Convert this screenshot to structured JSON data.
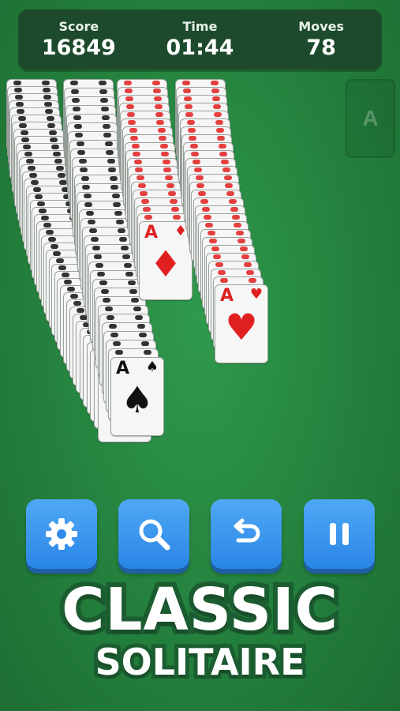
{
  "hud": {
    "score_label": "Score",
    "score_value": "16849",
    "time_label": "Time",
    "time_value": "01:44",
    "moves_label": "Moves",
    "moves_value": "78"
  },
  "foundation": {
    "placeholder_letter": "A"
  },
  "featured_cards": [
    {
      "rank": "A",
      "suit": "♣",
      "color": "#111111"
    },
    {
      "rank": "A",
      "suit": "♠",
      "color": "#111111"
    },
    {
      "rank": "A",
      "suit": "♦",
      "color": "#e02020"
    },
    {
      "rank": "A",
      "suit": "♥",
      "color": "#e02020"
    }
  ],
  "buttons": [
    {
      "name": "settings-button",
      "icon": "gear-icon"
    },
    {
      "name": "hint-button",
      "icon": "magnifier-icon"
    },
    {
      "name": "undo-button",
      "icon": "undo-arrow-icon"
    },
    {
      "name": "pause-button",
      "icon": "pause-icon"
    }
  ],
  "banner": {
    "line1": "CLASSIC",
    "line2": "SOLITAIRE"
  },
  "colors": {
    "felt": "#2a8c45",
    "hud_bg": "#1d4a2c",
    "button_blue": "#3a95ee",
    "red_suit": "#e02020"
  }
}
